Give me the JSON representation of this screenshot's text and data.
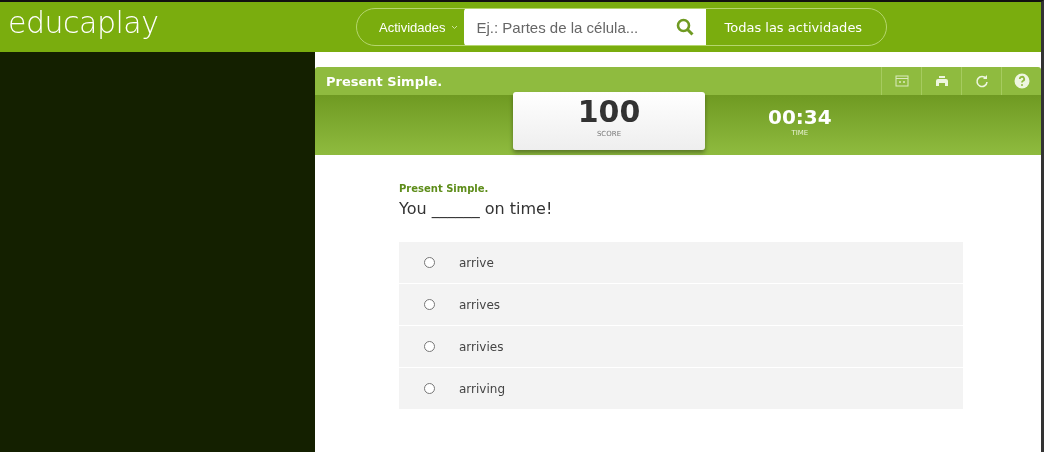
{
  "header": {
    "logo": "educaplay",
    "menu": "Actividades",
    "search": {
      "placeholder": "Ej.: Partes de la célula..."
    },
    "all_button": "Todas las actividades"
  },
  "activity": {
    "title": "Present Simple.",
    "score": "100",
    "score_label": "SCORE",
    "time": "00:34",
    "time_label": "TIME",
    "question_title": "Present Simple.",
    "question": "You ______ on time!",
    "options": [
      {
        "label": "arrive",
        "selected": false
      },
      {
        "label": "arrives",
        "selected": false
      },
      {
        "label": "arrivies",
        "selected": false
      },
      {
        "label": "arriving",
        "selected": false
      }
    ]
  }
}
